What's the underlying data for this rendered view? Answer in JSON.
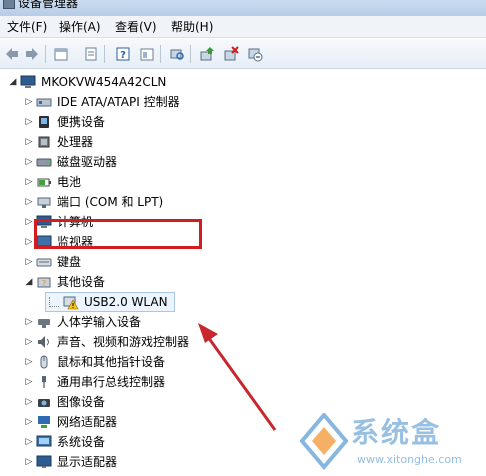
{
  "window": {
    "title": "设备管理器"
  },
  "menu": {
    "items": [
      {
        "label": "文件(F)"
      },
      {
        "label": "操作(A)"
      },
      {
        "label": "查看(V)"
      },
      {
        "label": "帮助(H)"
      }
    ]
  },
  "toolbar": {
    "icons": [
      "back-arrow-icon",
      "forward-arrow-icon",
      "properties-icon",
      "device-list-icon",
      "help-icon",
      "panel-icon",
      "scan-hardware-icon",
      "update-driver-icon",
      "uninstall-icon",
      "disable-device-icon"
    ]
  },
  "tree": {
    "root": "MKOKVW454A42CLN",
    "items": [
      {
        "label": "IDE ATA/ATAPI 控制器",
        "icon": "ide-controller-icon"
      },
      {
        "label": "便携设备",
        "icon": "portable-device-icon"
      },
      {
        "label": "处理器",
        "icon": "processor-icon"
      },
      {
        "label": "磁盘驱动器",
        "icon": "disk-drive-icon"
      },
      {
        "label": "电池",
        "icon": "battery-icon"
      },
      {
        "label": "端口 (COM 和 LPT)",
        "icon": "port-icon"
      },
      {
        "label": "计算机",
        "icon": "computer-icon"
      },
      {
        "label": "监视器",
        "icon": "monitor-icon"
      },
      {
        "label": "键盘",
        "icon": "keyboard-icon"
      },
      {
        "label": "其他设备",
        "icon": "other-devices-icon"
      },
      {
        "label": "USB2.0 WLAN",
        "icon": "unknown-device-warning-icon"
      },
      {
        "label": "人体学输入设备",
        "icon": "hid-icon"
      },
      {
        "label": "声音、视频和游戏控制器",
        "icon": "sound-icon"
      },
      {
        "label": "鼠标和其他指针设备",
        "icon": "mouse-icon"
      },
      {
        "label": "通用串行总线控制器",
        "icon": "usb-icon"
      },
      {
        "label": "图像设备",
        "icon": "camera-icon"
      },
      {
        "label": "网络适配器",
        "icon": "network-adapter-icon"
      },
      {
        "label": "系统设备",
        "icon": "system-device-icon"
      },
      {
        "label": "显示适配器",
        "icon": "display-adapter-icon"
      }
    ]
  },
  "watermark": {
    "brand": "系统盒",
    "url": "www.xitonghe.com"
  },
  "colors": {
    "highlight": "#d21c20",
    "watermark": "#87b6de"
  }
}
